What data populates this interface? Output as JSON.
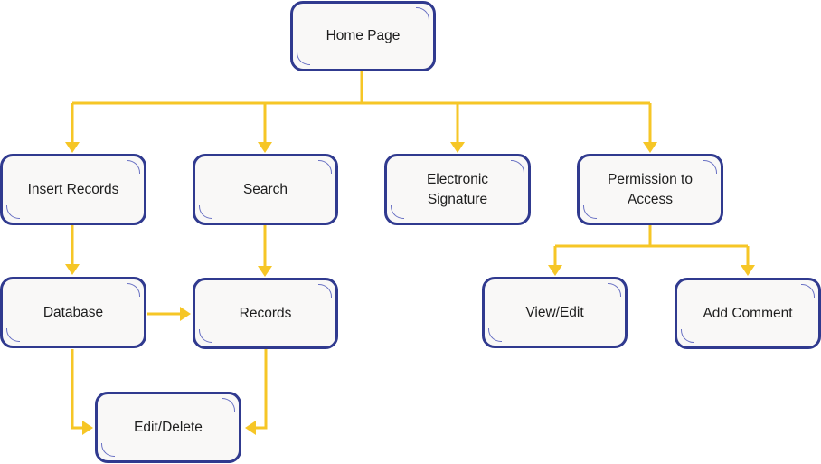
{
  "diagram": {
    "type": "flowchart",
    "colors": {
      "node_border": "#303a8f",
      "node_fill": "#f9f8f7",
      "connector": "#f6c626",
      "corner_accent": "#6a72c4"
    },
    "nodes": {
      "home": {
        "label": "Home Page"
      },
      "insert": {
        "label": "Insert Records"
      },
      "search": {
        "label": "Search"
      },
      "esign": {
        "label": "Electronic\nSignature"
      },
      "permission": {
        "label": "Permission to\nAccess"
      },
      "database": {
        "label": "Database"
      },
      "records": {
        "label": "Records"
      },
      "viewedit": {
        "label": "View/Edit"
      },
      "addcomment": {
        "label": "Add Comment"
      },
      "editdelete": {
        "label": "Edit/Delete"
      }
    },
    "edges": [
      {
        "from": "home",
        "to": "insert"
      },
      {
        "from": "home",
        "to": "search"
      },
      {
        "from": "home",
        "to": "esign"
      },
      {
        "from": "home",
        "to": "permission"
      },
      {
        "from": "insert",
        "to": "database"
      },
      {
        "from": "search",
        "to": "records"
      },
      {
        "from": "database",
        "to": "records"
      },
      {
        "from": "database",
        "to": "editdelete"
      },
      {
        "from": "records",
        "to": "editdelete"
      },
      {
        "from": "permission",
        "to": "viewedit"
      },
      {
        "from": "permission",
        "to": "addcomment"
      }
    ]
  }
}
